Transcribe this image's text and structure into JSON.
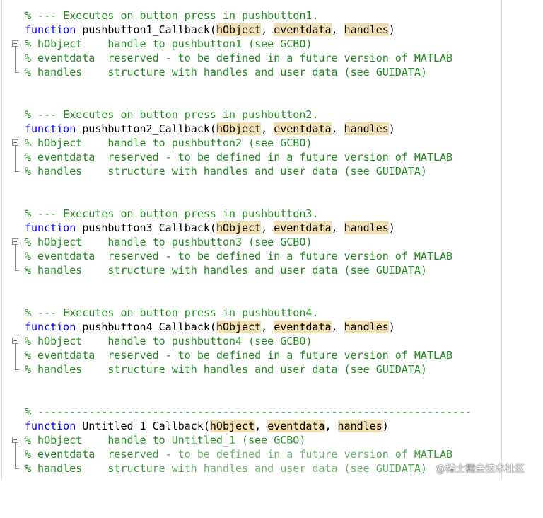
{
  "blocks": [
    {
      "header_comment": "% --- Executes on button press in pushbutton1.",
      "keyword": "function",
      "name": "pushbutton1_Callback",
      "open": "(",
      "arg1": "hObject",
      "sep1": ", ",
      "arg2": "eventdata",
      "sep2": ", ",
      "arg3": "handles",
      "close": ")",
      "c1": "% hObject    handle to pushbutton1 (see GCBO)",
      "c2": "% eventdata  reserved - to be defined in a future version of MATLAB",
      "c3": "% handles    structure with handles and user data (see GUIDATA)"
    },
    {
      "header_comment": "% --- Executes on button press in pushbutton2.",
      "keyword": "function",
      "name": "pushbutton2_Callback",
      "open": "(",
      "arg1": "hObject",
      "sep1": ", ",
      "arg2": "eventdata",
      "sep2": ", ",
      "arg3": "handles",
      "close": ")",
      "c1": "% hObject    handle to pushbutton2 (see GCBO)",
      "c2": "% eventdata  reserved - to be defined in a future version of MATLAB",
      "c3": "% handles    structure with handles and user data (see GUIDATA)"
    },
    {
      "header_comment": "% --- Executes on button press in pushbutton3.",
      "keyword": "function",
      "name": "pushbutton3_Callback",
      "open": "(",
      "arg1": "hObject",
      "sep1": ", ",
      "arg2": "eventdata",
      "sep2": ", ",
      "arg3": "handles",
      "close": ")",
      "c1": "% hObject    handle to pushbutton3 (see GCBO)",
      "c2": "% eventdata  reserved - to be defined in a future version of MATLAB",
      "c3": "% handles    structure with handles and user data (see GUIDATA)"
    },
    {
      "header_comment": "% --- Executes on button press in pushbutton4.",
      "keyword": "function",
      "name": "pushbutton4_Callback",
      "open": "(",
      "arg1": "hObject",
      "sep1": ", ",
      "arg2": "eventdata",
      "sep2": ", ",
      "arg3": "handles",
      "close": ")",
      "c1": "% hObject    handle to pushbutton4 (see GCBO)",
      "c2": "% eventdata  reserved - to be defined in a future version of MATLAB",
      "c3": "% handles    structure with handles and user data (see GUIDATA)"
    },
    {
      "header_comment": "% --------------------------------------------------------------------",
      "keyword": "function",
      "name": "Untitled_1_Callback",
      "open": "(",
      "arg1": "hObject",
      "sep1": ", ",
      "arg2": "eventdata",
      "sep2": ", ",
      "arg3": "handles",
      "close": ")",
      "c1": "% hObject    handle to Untitled_1 (see GCBO)",
      "c2": "% eventdata  reserved - to be defined in a future version of MATLAB",
      "c3": "% handles    structure with handles and user data (see GUIDATA)"
    }
  ],
  "watermark": "@稀土掘金技术社区",
  "colors": {
    "comment": "#228b22",
    "keyword": "#0000ff",
    "highlight": "#f2e0b2"
  }
}
